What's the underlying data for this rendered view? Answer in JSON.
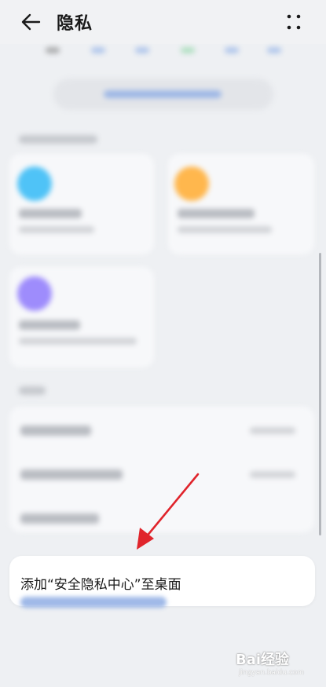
{
  "header": {
    "title": "隐私",
    "back_icon": "back-arrow-icon",
    "more_icon": "more-dots-icon"
  },
  "popup": {
    "text": "添加“安全隐私中心”至桌面"
  },
  "watermark": {
    "text": "Bai经验",
    "url": "jingyan.baidu.com"
  },
  "colors": {
    "accent_blue": "#4a90e2",
    "annotation_red": "#e0242b",
    "card_cyan": "#4fc3f7",
    "card_orange": "#ffb74d",
    "card_purple": "#9e8cfc"
  }
}
